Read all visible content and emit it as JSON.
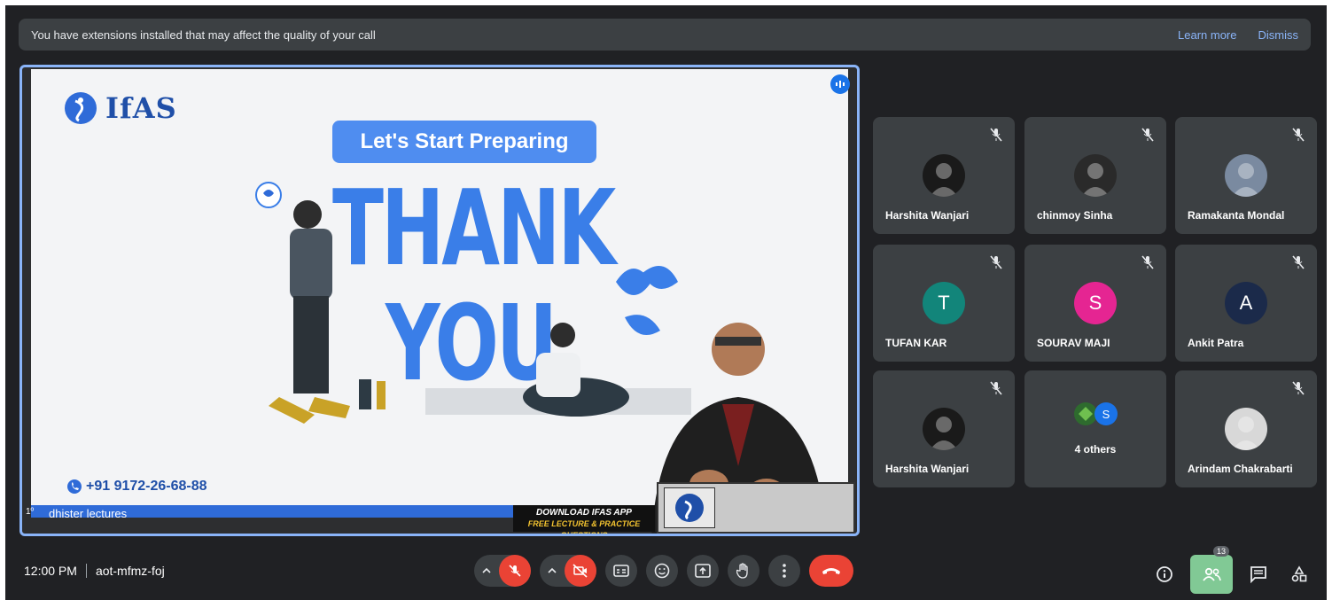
{
  "banner": {
    "message": "You have extensions installed that may affect the quality of your call",
    "learn_more": "Learn more",
    "dismiss": "Dismiss"
  },
  "presentation": {
    "brand": "IfAS",
    "pill_text": "Let's Start Preparing",
    "headline_1": "THANK",
    "headline_2": "YOU",
    "phone": "+91 9172-26-68-88",
    "presenter_name": "dhister lectures",
    "download_1": "DOWNLOAD IFAS APP",
    "download_2": "FREE LECTURE & PRACTICE QUESTIONS",
    "mini_label": "1º"
  },
  "participants": [
    {
      "name": "Harshita Wanjari",
      "avatar": "photo",
      "color": "#1a1a1a"
    },
    {
      "name": "chinmoy Sinha",
      "avatar": "photo",
      "color": "#2a2a2a"
    },
    {
      "name": "Ramakanta Mondal",
      "avatar": "photo",
      "color": "#7a8aa0"
    },
    {
      "name": "TUFAN KAR",
      "avatar": "T",
      "color": "#12857a"
    },
    {
      "name": "SOURAV MAJI",
      "avatar": "S",
      "color": "#e52592"
    },
    {
      "name": "Ankit Patra",
      "avatar": "A",
      "color": "#1b2a4a"
    },
    {
      "name": "Harshita Wanjari",
      "avatar": "photo",
      "color": "#1a1a1a"
    },
    {
      "name": "4 others",
      "avatar": "S",
      "color": "#1a73e8"
    },
    {
      "name": "Arindam Chakrabarti",
      "avatar": "photo",
      "color": "#d8d8d8"
    }
  ],
  "bottom": {
    "time": "12:00 PM",
    "meeting_code": "aot-mfmz-foj",
    "participant_count": "13"
  },
  "colors": {
    "accent": "#8ab4f8",
    "danger": "#ea4335",
    "people_active": "#81c995"
  }
}
